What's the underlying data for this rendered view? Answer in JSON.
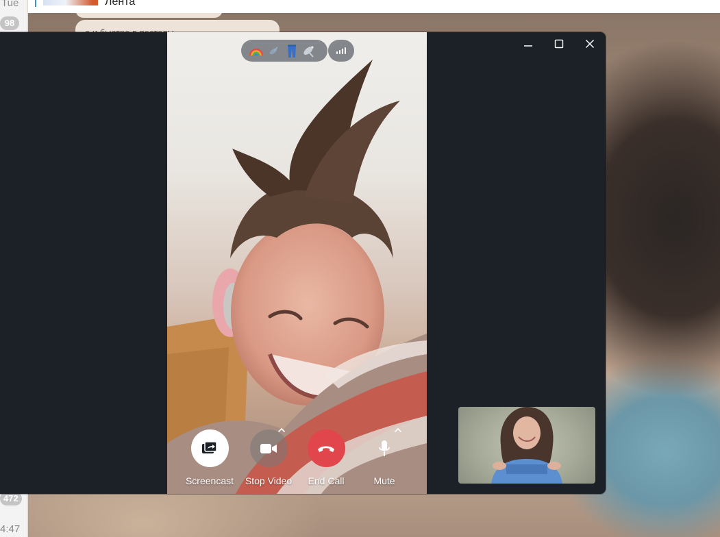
{
  "background_app": {
    "header_name": "Лента",
    "bubble_snippet": "а и быстро в постелы",
    "chat_list": [
      {
        "time": "Tue",
        "badge": "98"
      },
      {
        "time": "4:47",
        "badge": "472"
      }
    ]
  },
  "call": {
    "status_emojis": [
      "rainbow",
      "satellite-dish-small",
      "jeans",
      "satellite-antenna"
    ],
    "window_controls": {
      "minimize": "minimize",
      "maximize": "maximize",
      "close": "close"
    },
    "controls": {
      "screencast": "Screencast",
      "stop_video": "Stop Video",
      "end_call": "End Call",
      "mute": "Mute"
    },
    "colors": {
      "end_call": "#e0464c",
      "window_bg": "#1b2127"
    }
  }
}
